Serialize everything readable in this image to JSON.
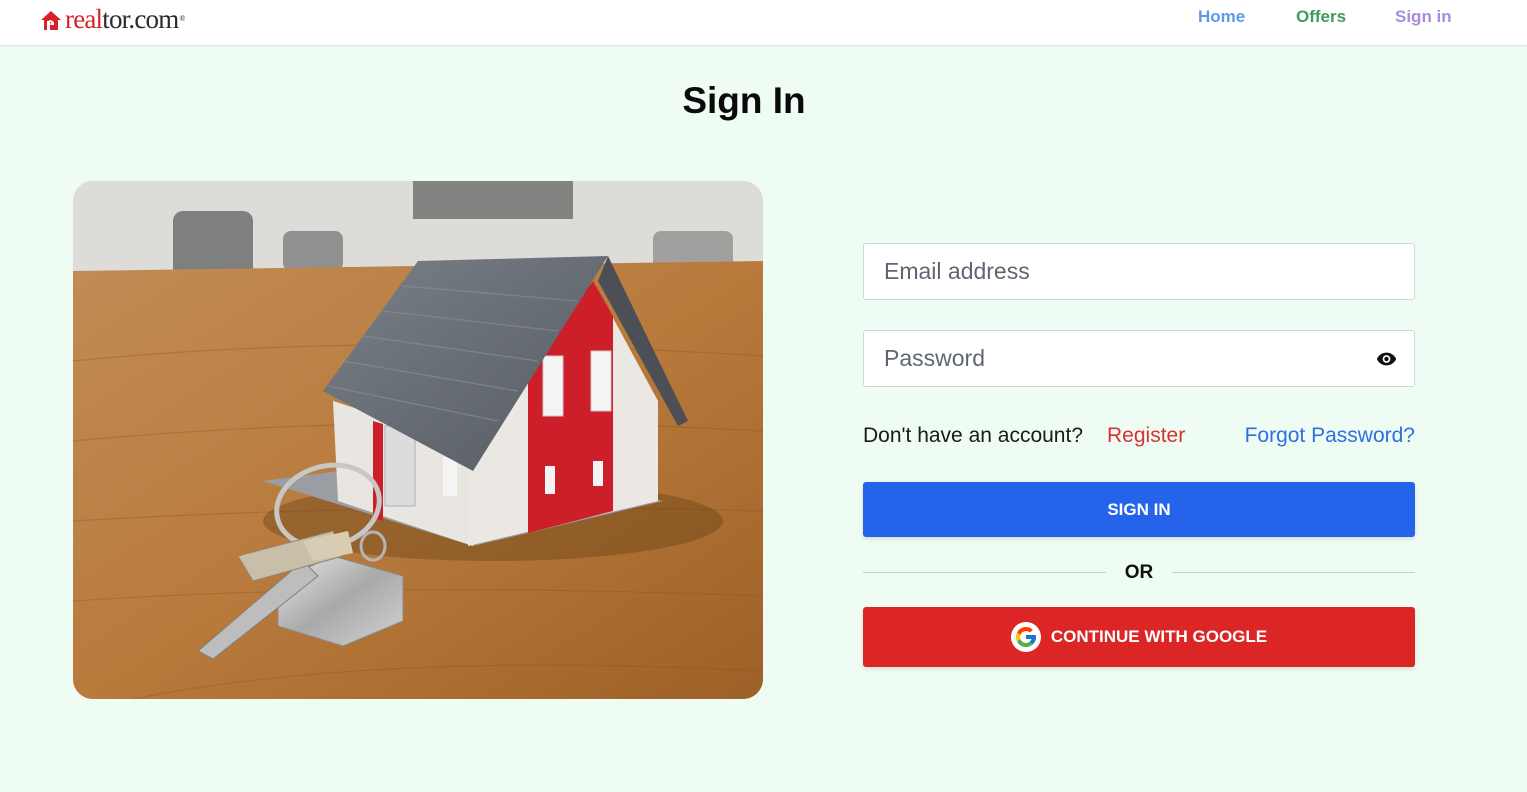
{
  "header": {
    "logo": {
      "brand_part1": "real",
      "brand_part2": "tor.com",
      "trademark": "®"
    },
    "nav": {
      "home": "Home",
      "offers": "Offers",
      "signin": "Sign in"
    },
    "nav_colors": {
      "home": "#5b9bea",
      "offers": "#3f9c5a",
      "signin": "#a98be0"
    }
  },
  "page": {
    "title": "Sign In",
    "background": "#effcf3"
  },
  "hero_image": {
    "subject": "house-with-keys-photo"
  },
  "form": {
    "email": {
      "placeholder": "Email address",
      "value": ""
    },
    "password": {
      "placeholder": "Password",
      "value": "",
      "toggle_icon": "eye-icon"
    },
    "no_account_text": "Don't have an account?",
    "register_link": "Register",
    "forgot_link": "Forgot Password?",
    "signin_button": "SIGN IN",
    "divider_text": "OR",
    "google_button": "CONTINUE WITH GOOGLE",
    "google_icon": "google-g-icon"
  },
  "colors": {
    "primary_button": "#2563eb",
    "google_button": "#dc2626",
    "register_link": "#d63333",
    "forgot_link": "#2f6fe4"
  }
}
